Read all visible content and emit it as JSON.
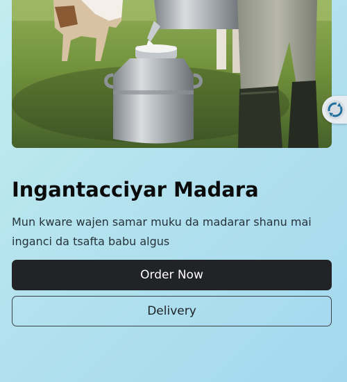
{
  "product": {
    "title": "Ingantacciyar Madara",
    "description": "Mun kware wajen samar muku da madarar shanu mai inganci da tsafta babu algus"
  },
  "actions": {
    "order_label": "Order Now",
    "delivery_label": "Delivery"
  },
  "colors": {
    "primary_button": "#212327",
    "page_background": "#b3e2ee"
  },
  "icons": {
    "scroll_widget": "refresh-icon"
  }
}
